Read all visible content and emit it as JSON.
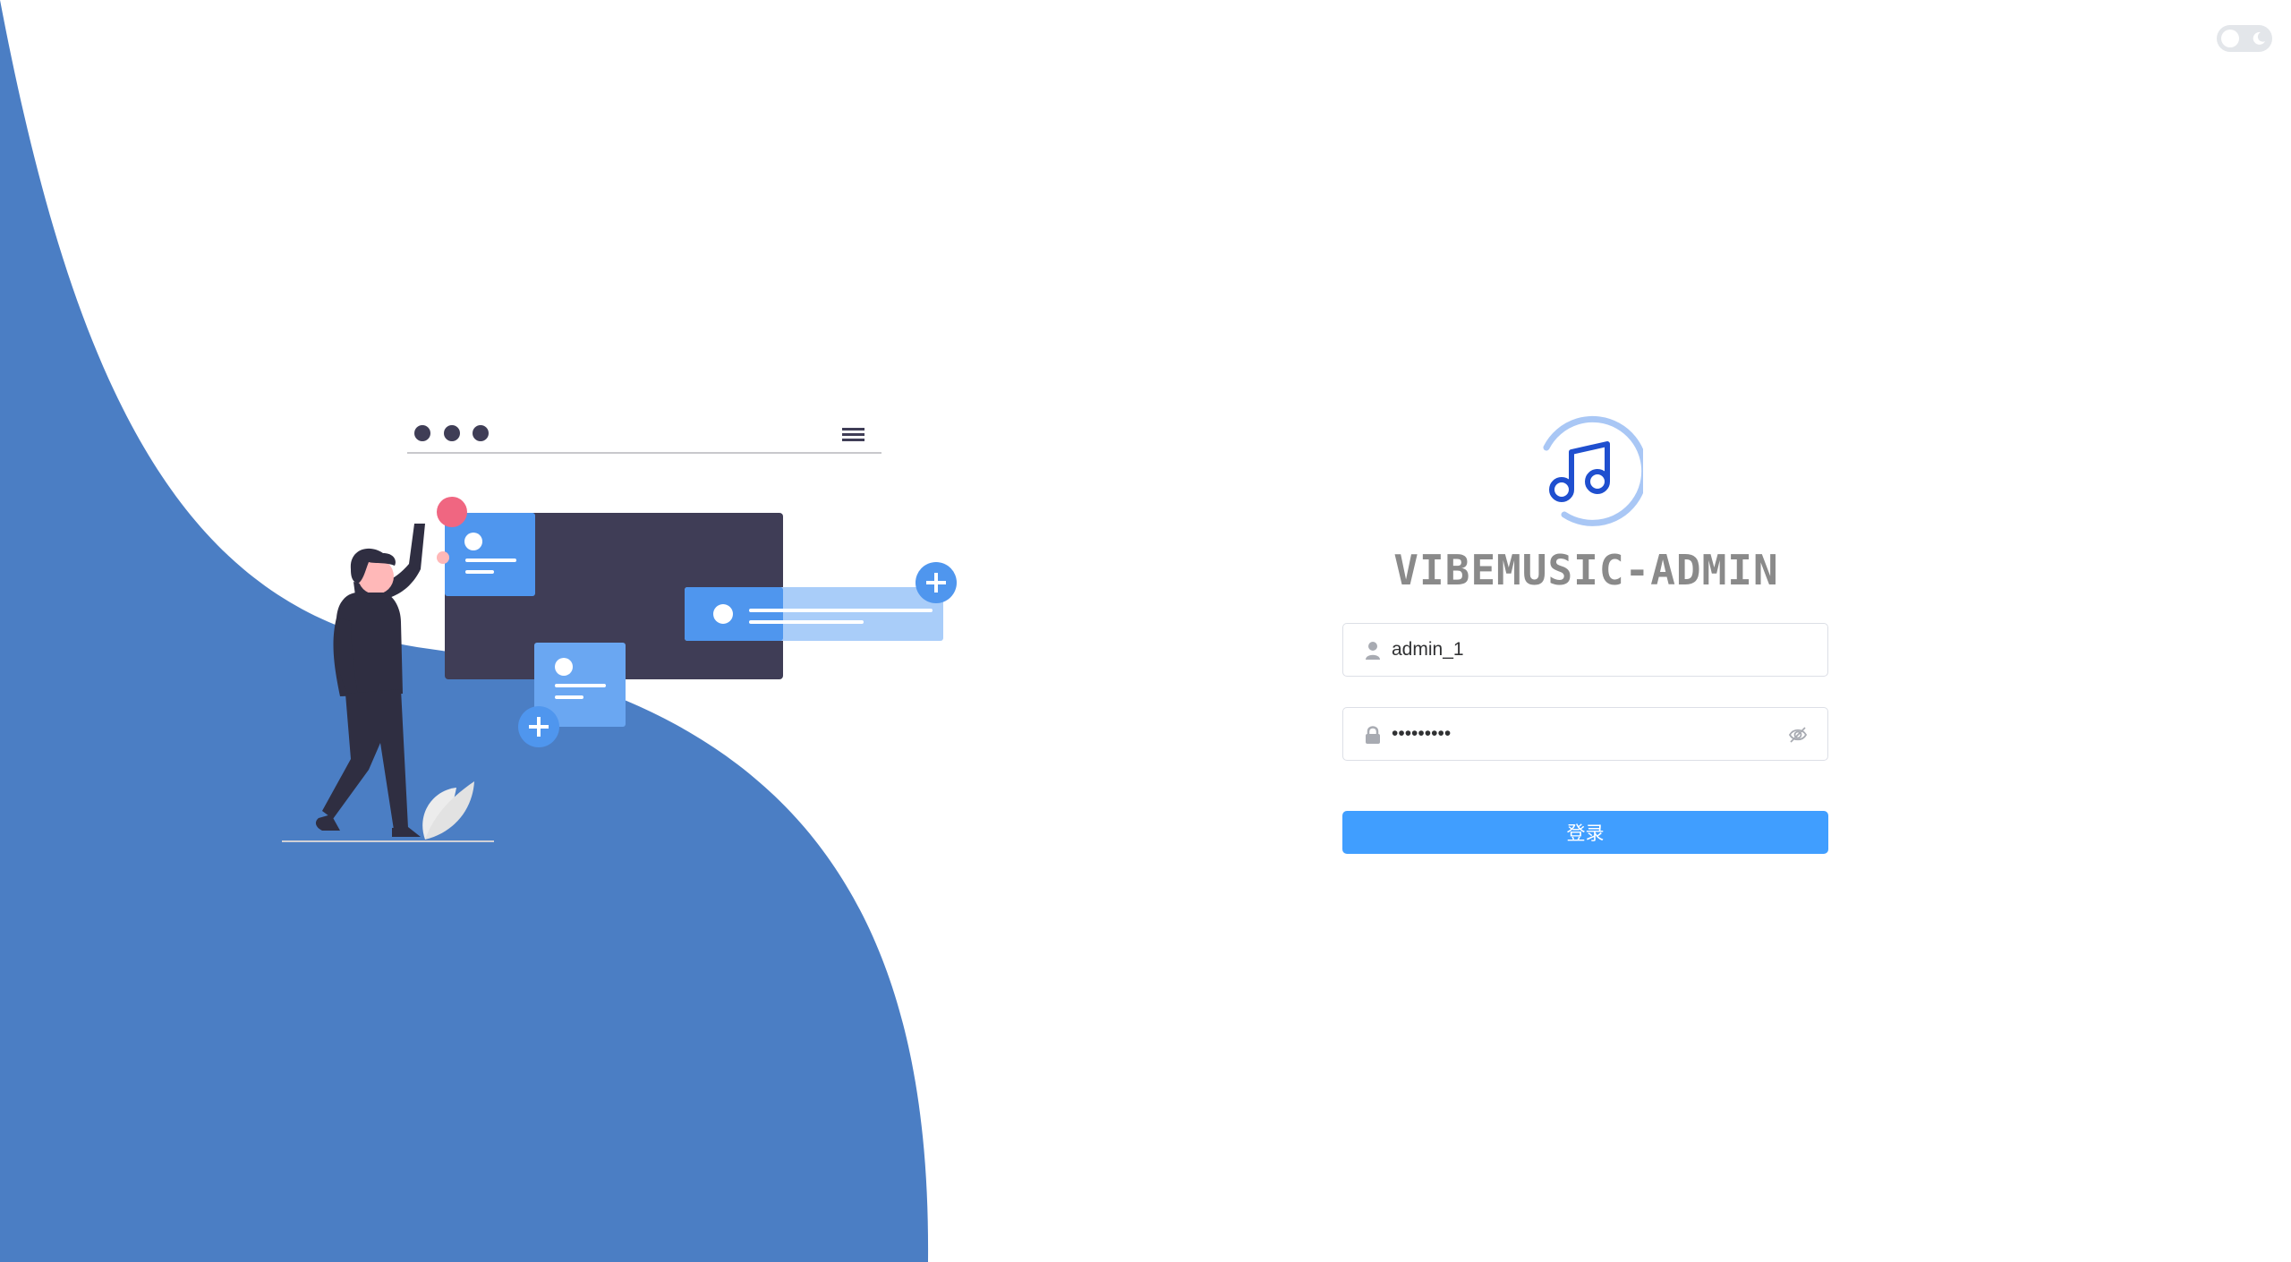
{
  "app": {
    "title": "VIBEMUSIC-ADMIN",
    "logo_icon": "music-note-icon"
  },
  "theme_toggle": {
    "icon": "moon-icon",
    "dark_mode": false
  },
  "login_form": {
    "username": {
      "value": "admin_1",
      "icon": "user-icon"
    },
    "password": {
      "value": "123456789",
      "icon": "lock-icon",
      "toggle_icon": "eye-hidden-icon"
    },
    "submit_label": "登录"
  },
  "colors": {
    "accent": "#409eff",
    "wave": "#4b7ec4",
    "illustration_dark": "#3f3d56",
    "illustration_blue": "#4f96ee",
    "illustration_red": "#f06681",
    "title": "#8a8a8a"
  }
}
